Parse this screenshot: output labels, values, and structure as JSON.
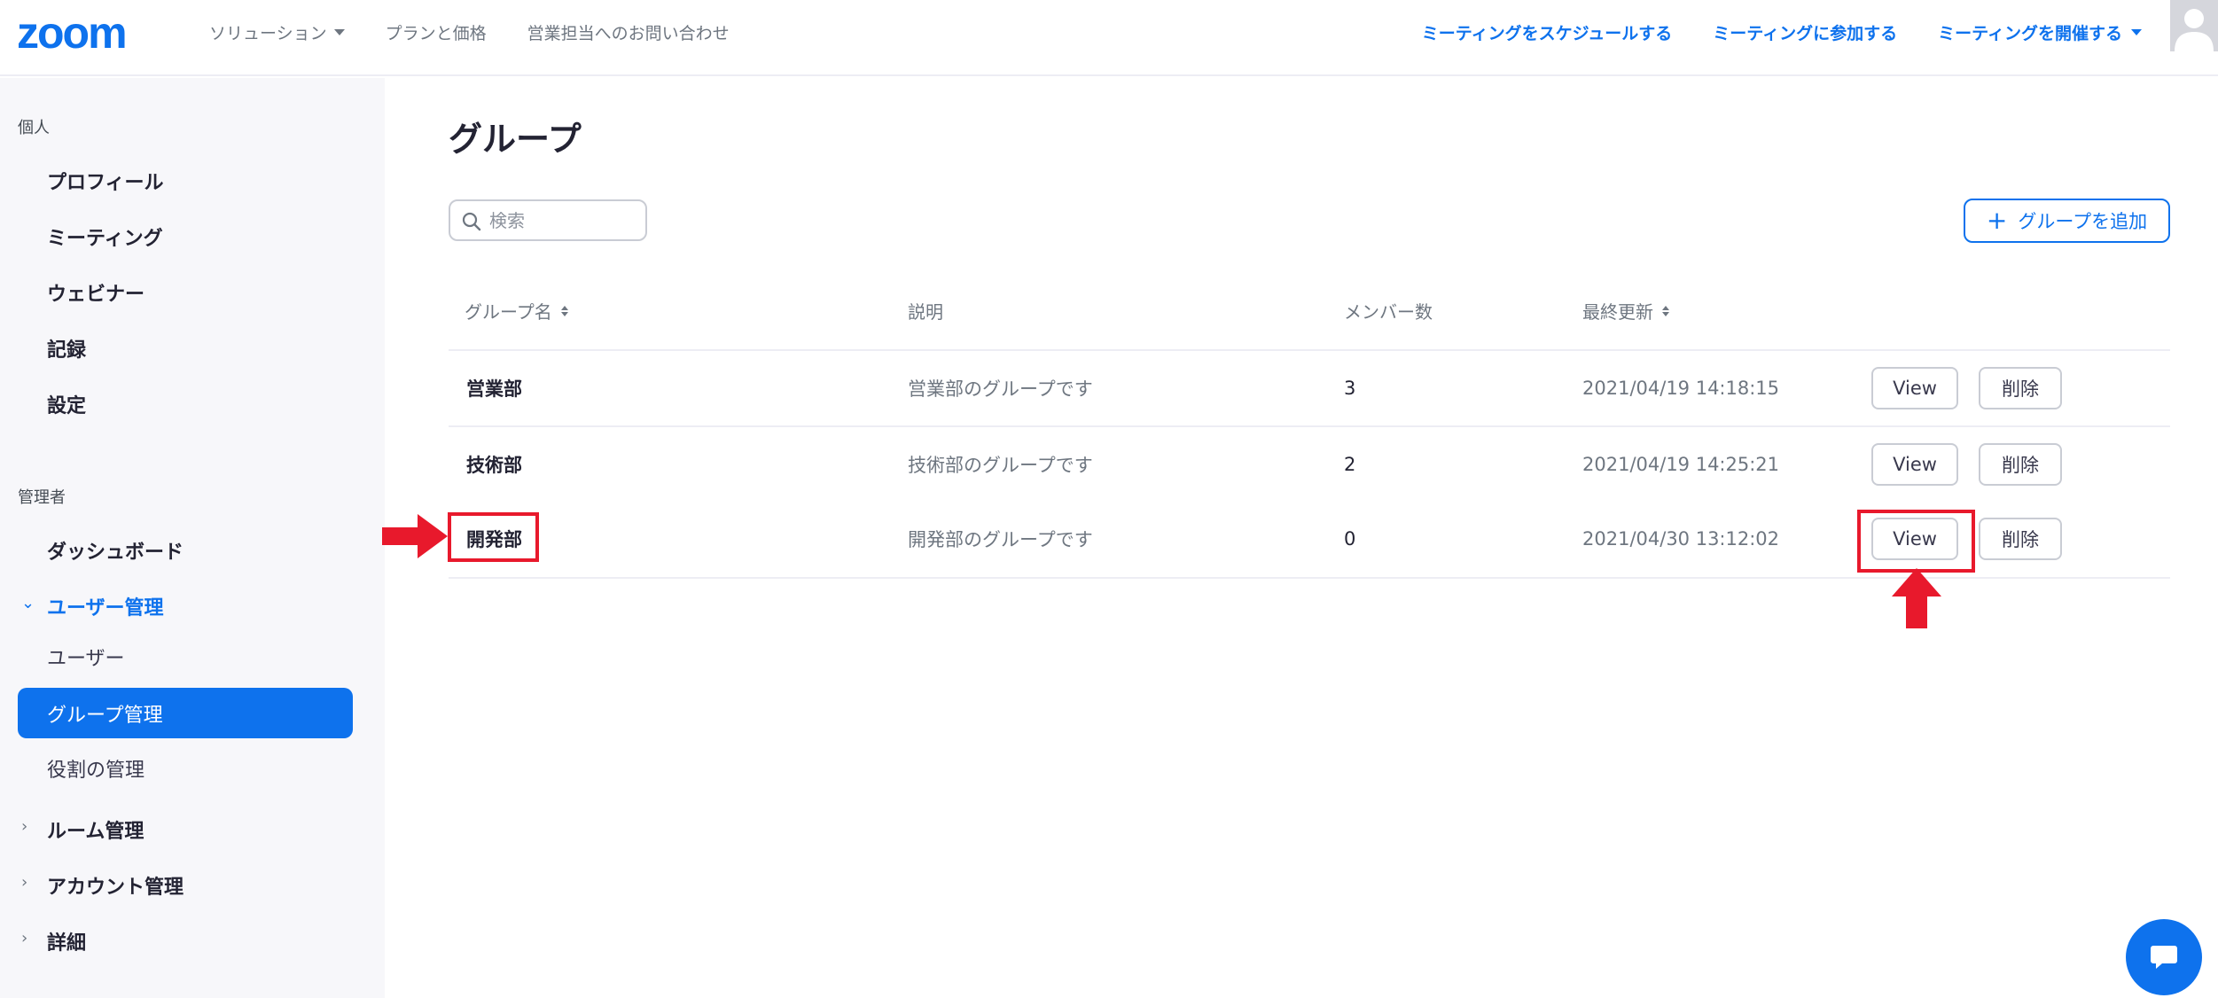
{
  "header": {
    "logo_text": "zoom",
    "nav_left": [
      {
        "label": "ソリューション",
        "has_dropdown": true
      },
      {
        "label": "プランと価格",
        "has_dropdown": false
      },
      {
        "label": "営業担当へのお問い合わせ",
        "has_dropdown": false
      }
    ],
    "nav_right": [
      {
        "label": "ミーティングをスケジュールする",
        "has_dropdown": false
      },
      {
        "label": "ミーティングに参加する",
        "has_dropdown": false
      },
      {
        "label": "ミーティングを開催する",
        "has_dropdown": true
      }
    ],
    "accent_color": "#0e72ed"
  },
  "sidebar": {
    "personal_label": "個人",
    "personal_items": [
      "プロフィール",
      "ミーティング",
      "ウェビナー",
      "記録",
      "設定"
    ],
    "admin_label": "管理者",
    "dashboard": "ダッシュボード",
    "user_mgmt": {
      "label": "ユーザー管理",
      "children": [
        "ユーザー",
        "グループ管理",
        "役割の管理"
      ],
      "active_child": "グループ管理"
    },
    "room_mgmt": "ルーム管理",
    "account_mgmt": "アカウント管理",
    "details": "詳細"
  },
  "main": {
    "title": "グループ",
    "search_placeholder": "検索",
    "add_group_label": "グループを追加",
    "columns": [
      "グループ名",
      "説明",
      "メンバー数",
      "最終更新"
    ],
    "rows": [
      {
        "name": "営業部",
        "description": "営業部のグループです",
        "members": "3",
        "updated": "2021/04/19 14:18:15",
        "view_label": "View",
        "delete_label": "削除"
      },
      {
        "name": "技術部",
        "description": "技術部のグループです",
        "members": "2",
        "updated": "2021/04/19 14:25:21",
        "view_label": "View",
        "delete_label": "削除"
      },
      {
        "name": "開発部",
        "description": "開発部のグループです",
        "members": "0",
        "updated": "2021/04/30 13:12:02",
        "view_label": "View",
        "delete_label": "削除"
      }
    ]
  },
  "annotations": {
    "highlight_color": "#e8192c",
    "highlighted": [
      "開発部 group name",
      "開発部 View button"
    ]
  }
}
